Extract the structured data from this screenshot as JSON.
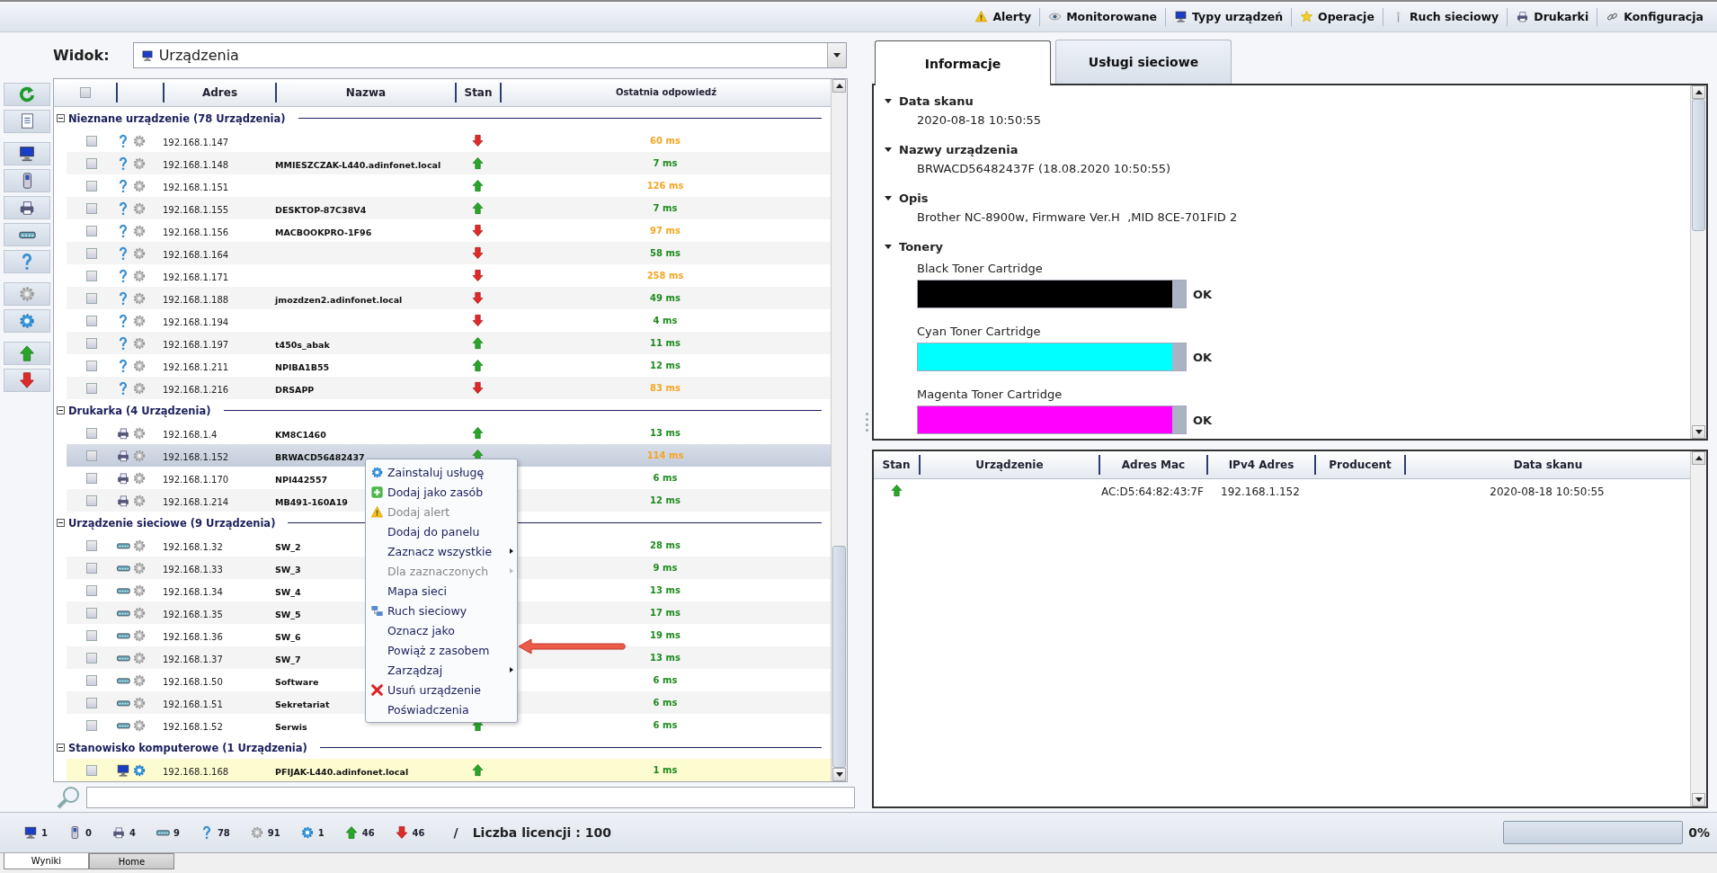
{
  "top_nav": [
    {
      "kind": "warning",
      "label": "Alerty"
    },
    {
      "kind": "eye",
      "label": "Monitorowane"
    },
    {
      "kind": "monitor",
      "label": "Typy urządzeń"
    },
    {
      "kind": "star",
      "label": "Operacje"
    },
    {
      "kind": "antenna",
      "label": "Ruch sieciowy"
    },
    {
      "kind": "printer",
      "label": "Drukarki"
    },
    {
      "kind": "link",
      "label": "Konfiguracja"
    }
  ],
  "view": {
    "label": "Widok:",
    "value": "Urządzenia"
  },
  "left_toolbar": [
    {
      "kind": "refresh"
    },
    {
      "kind": "document"
    },
    {
      "kind": "monitor"
    },
    {
      "kind": "phone"
    },
    {
      "kind": "printer"
    },
    {
      "kind": "switch"
    },
    {
      "kind": "question"
    },
    {
      "kind": "gear"
    },
    {
      "kind": "bluegear"
    },
    {
      "kind": "up"
    },
    {
      "kind": "down"
    }
  ],
  "table": {
    "select_all": false,
    "columns": [
      "Adres",
      "Nazwa",
      "Stan",
      "Ostatnia odpowiedź"
    ],
    "groups": [
      {
        "title": "Nieznane urządzenie (78 Urządzenia)",
        "expanded": true,
        "kind": "question",
        "rows": [
          {
            "checked": false,
            "ip": "192.168.1.147",
            "name": "",
            "online": false,
            "latency": "60 ms",
            "color": "#f5a623",
            "selected": false,
            "highlighted": false
          },
          {
            "checked": false,
            "ip": "192.168.1.148",
            "name": "MMIESZCZAK-L440.adinfonet.local",
            "online": true,
            "latency": "7 ms",
            "color": "#1e8a1e",
            "selected": false,
            "highlighted": false
          },
          {
            "checked": false,
            "ip": "192.168.1.151",
            "name": "",
            "online": true,
            "latency": "126 ms",
            "color": "#f5a623",
            "selected": false,
            "highlighted": false
          },
          {
            "checked": false,
            "ip": "192.168.1.155",
            "name": "DESKTOP-87C38V4",
            "online": true,
            "latency": "7 ms",
            "color": "#1e8a1e",
            "selected": false,
            "highlighted": false
          },
          {
            "checked": false,
            "ip": "192.168.1.156",
            "name": "MACBOOKPRO-1F96",
            "online": false,
            "latency": "97 ms",
            "color": "#f5a623",
            "selected": false,
            "highlighted": false
          },
          {
            "checked": false,
            "ip": "192.168.1.164",
            "name": "",
            "online": false,
            "latency": "58 ms",
            "color": "#1e8a1e",
            "selected": false,
            "highlighted": false
          },
          {
            "checked": false,
            "ip": "192.168.1.171",
            "name": "",
            "online": false,
            "latency": "258 ms",
            "color": "#f5a623",
            "selected": false,
            "highlighted": false
          },
          {
            "checked": false,
            "ip": "192.168.1.188",
            "name": "jmozdzen2.adinfonet.local",
            "online": false,
            "latency": "49 ms",
            "color": "#1e8a1e",
            "selected": false,
            "highlighted": false
          },
          {
            "checked": false,
            "ip": "192.168.1.194",
            "name": "",
            "online": false,
            "latency": "4 ms",
            "color": "#1e8a1e",
            "selected": false,
            "highlighted": false
          },
          {
            "checked": false,
            "ip": "192.168.1.197",
            "name": "t450s_abak",
            "online": true,
            "latency": "11 ms",
            "color": "#1e8a1e",
            "selected": false,
            "highlighted": false
          },
          {
            "checked": false,
            "ip": "192.168.1.211",
            "name": "NPIBA1B55",
            "online": true,
            "latency": "12 ms",
            "color": "#1e8a1e",
            "selected": false,
            "highlighted": false
          },
          {
            "checked": false,
            "ip": "192.168.1.216",
            "name": "DRSAPP",
            "online": false,
            "latency": "83 ms",
            "color": "#f5a623",
            "selected": false,
            "highlighted": false
          }
        ]
      },
      {
        "title": "Drukarka (4 Urządzenia)",
        "expanded": true,
        "kind": "printer",
        "rows": [
          {
            "checked": false,
            "ip": "192.168.1.4",
            "name": "KM8C1460",
            "online": true,
            "latency": "13 ms",
            "color": "#1e8a1e",
            "selected": false,
            "highlighted": false
          },
          {
            "checked": false,
            "ip": "192.168.1.152",
            "name": "BRWACD56482437",
            "online": true,
            "latency": "114 ms",
            "color": "#f5a623",
            "selected": true,
            "highlighted": false
          },
          {
            "checked": false,
            "ip": "192.168.1.170",
            "name": "NPI442557",
            "latency": "6 ms",
            "color": "#1e8a1e",
            "selected": false,
            "highlighted": false
          },
          {
            "checked": false,
            "ip": "192.168.1.214",
            "name": "MB491-160A19",
            "latency": "12 ms",
            "color": "#1e8a1e",
            "selected": false,
            "highlighted": false
          }
        ]
      },
      {
        "title": "Urządzenie sieciowe (9 Urządzenia)",
        "expanded": true,
        "kind": "switch",
        "rows": [
          {
            "checked": false,
            "ip": "192.168.1.32",
            "name": "SW_2",
            "latency": "28 ms",
            "color": "#1e8a1e",
            "selected": false,
            "highlighted": false
          },
          {
            "checked": false,
            "ip": "192.168.1.33",
            "name": "SW_3",
            "latency": "9 ms",
            "color": "#1e8a1e",
            "selected": false,
            "highlighted": false
          },
          {
            "checked": false,
            "ip": "192.168.1.34",
            "name": "SW_4",
            "latency": "13 ms",
            "color": "#1e8a1e",
            "selected": false,
            "highlighted": false
          },
          {
            "checked": false,
            "ip": "192.168.1.35",
            "name": "SW_5",
            "latency": "17 ms",
            "color": "#1e8a1e",
            "selected": false,
            "highlighted": false
          },
          {
            "checked": false,
            "ip": "192.168.1.36",
            "name": "SW_6",
            "latency": "19 ms",
            "color": "#1e8a1e",
            "selected": false,
            "highlighted": false
          },
          {
            "checked": false,
            "ip": "192.168.1.37",
            "name": "SW_7",
            "latency": "13 ms",
            "color": "#1e8a1e",
            "selected": false,
            "highlighted": false
          },
          {
            "checked": false,
            "ip": "192.168.1.50",
            "name": "Software",
            "latency": "6 ms",
            "color": "#1e8a1e",
            "selected": false,
            "highlighted": false
          },
          {
            "checked": false,
            "ip": "192.168.1.51",
            "name": "Sekretariat",
            "latency": "6 ms",
            "color": "#1e8a1e",
            "selected": false,
            "highlighted": false
          },
          {
            "checked": false,
            "ip": "192.168.1.52",
            "name": "Serwis",
            "online": true,
            "latency": "6 ms",
            "color": "#1e8a1e",
            "selected": false,
            "highlighted": false
          }
        ]
      },
      {
        "title": "Stanowisko komputerowe (1 Urządzenia)",
        "expanded": true,
        "kind": "monitor",
        "rows": [
          {
            "checked": false,
            "ip": "192.168.1.168",
            "name": "PFIJAK-L440.adinfonet.local",
            "online": true,
            "latency": "1 ms",
            "color": "#1e8a1e",
            "selected": false,
            "highlighted": true
          }
        ]
      }
    ]
  },
  "context_menu": [
    {
      "label": "Zainstaluj usługę",
      "kind": "gear",
      "disabled": false,
      "submenu": false
    },
    {
      "label": "Dodaj jako zasób",
      "kind": "plus",
      "disabled": false,
      "submenu": false
    },
    {
      "label": "Dodaj alert",
      "kind": "warning",
      "disabled": true,
      "submenu": false
    },
    {
      "label": "Dodaj do panelu",
      "kind": "plain",
      "disabled": false,
      "submenu": false
    },
    {
      "label": "Zaznacz wszystkie",
      "kind": "plain",
      "disabled": false,
      "submenu": true
    },
    {
      "label": "Dla zaznaczonych",
      "kind": "plain",
      "disabled": true,
      "submenu": true
    },
    {
      "label": "Mapa sieci",
      "kind": "plain",
      "disabled": false,
      "submenu": false
    },
    {
      "label": "Ruch sieciowy",
      "kind": "network",
      "disabled": false,
      "submenu": false
    },
    {
      "label": "Oznacz jako",
      "kind": "plain",
      "disabled": false,
      "submenu": false
    },
    {
      "label": "Powiąż z zasobem",
      "kind": "plain",
      "disabled": false,
      "submenu": false
    },
    {
      "label": "Zarządzaj",
      "kind": "plain",
      "disabled": false,
      "submenu": true
    },
    {
      "label": "Usuń urządzenie",
      "kind": "delete",
      "disabled": false,
      "submenu": false
    },
    {
      "label": "Poświadczenia",
      "kind": "plain",
      "disabled": false,
      "submenu": false
    }
  ],
  "right_tabs": [
    {
      "label": "Informacje",
      "selected": true
    },
    {
      "label": "Usługi sieciowe",
      "selected": false
    }
  ],
  "info_sections": [
    {
      "kind": "text",
      "title": "Data skanu",
      "expanded": true,
      "lines": [
        "2020-08-18 10:50:55"
      ]
    },
    {
      "kind": "text",
      "title": "Nazwy urządzenia",
      "expanded": true,
      "lines": [
        "BRWACD56482437F (18.08.2020 10:50:55)"
      ]
    },
    {
      "kind": "text",
      "title": "Opis",
      "expanded": true,
      "lines": [
        "Brother NC-8900w, Firmware Ver.H  ,MID 8CE-701FID 2"
      ]
    },
    {
      "kind": "toners",
      "title": "Tonery",
      "expanded": true,
      "toners": [
        {
          "name": "Black Toner Cartridge",
          "color": "#000000",
          "level": 0.95,
          "status": "OK"
        },
        {
          "name": "Cyan Toner Cartridge",
          "color": "#00ffff",
          "level": 0.95,
          "status": "OK"
        },
        {
          "name": "Magenta Toner Cartridge",
          "color": "#ff00ff",
          "level": 0.95,
          "status": "OK"
        }
      ]
    }
  ],
  "services_table": {
    "columns": [
      "Stan",
      "Urządzenie",
      "Adres Mac",
      "IPv4 Adres",
      "Producent",
      "Data skanu"
    ],
    "rows": [
      {
        "online": true,
        "mac": "AC:D5:64:82:43:7F",
        "ipv4": "192.168.1.152",
        "scan_date": "2020-08-18 10:50:55"
      }
    ]
  },
  "status_bar": {
    "counts": [
      {
        "kind": "monitor",
        "value": "1"
      },
      {
        "kind": "phone",
        "value": "0"
      },
      {
        "kind": "printer",
        "value": "4"
      },
      {
        "kind": "switch",
        "value": "9"
      },
      {
        "kind": "question",
        "value": "78"
      },
      {
        "kind": "gear",
        "value": "91"
      },
      {
        "kind": "bluegear",
        "value": "1"
      },
      {
        "kind": "up",
        "value": "46"
      },
      {
        "kind": "down",
        "value": "46"
      }
    ],
    "separator": "/",
    "license": "Liczba licencji : 100",
    "progress": {
      "level": 0,
      "reading": "0%"
    }
  },
  "bottom_tabs": [
    {
      "label": "Wyniki",
      "selected": true
    },
    {
      "label": "Home",
      "selected": false
    }
  ]
}
